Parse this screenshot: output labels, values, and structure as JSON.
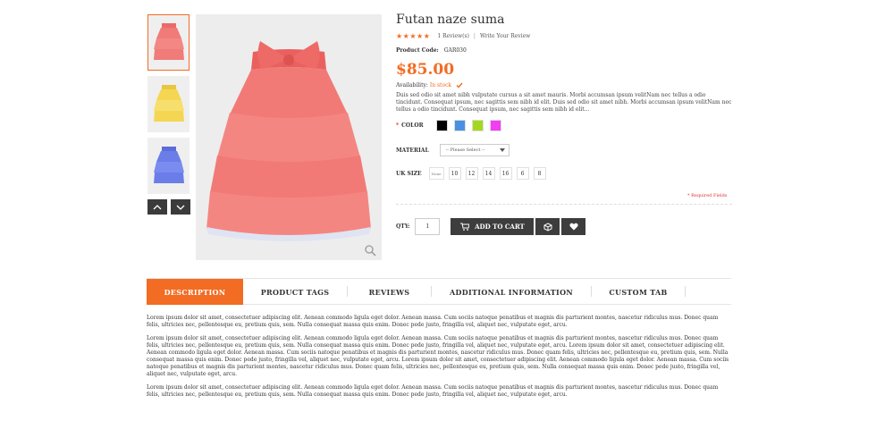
{
  "product": {
    "title": "Futan naze suma",
    "reviews_label": "1 Review(s)",
    "write_review_label": "Write Your Review",
    "code_label": "Product Code:",
    "code_value": "GAR030",
    "price": "$85.00",
    "availability_label": "Availability:",
    "availability_value": "In stock",
    "description": "Duis sed odio sit amet nibh vulputate cursus a sit amet mauris. Morbi accumsan ipsum velitNam nec tellus a odio tincidunt. Consequat ipsum, nec sagittis sem nibh id elit. Duis sed odio sit amet nibh. Morbi accumsan ipsum velitNam nec tellus a odio tincidunt. Consequat ipsum, nec sagittis sem nibh id elit..."
  },
  "rating": {
    "value": 5,
    "max": 5,
    "stars": "★★★★★"
  },
  "options": {
    "required_mark": "*",
    "color_label": "COLOR",
    "colors": [
      "#000000",
      "#4a90e2",
      "#a4d81a",
      "#f23df2"
    ],
    "material_label": "MATERIAL",
    "material_placeholder": "-- Please Select --",
    "size_label": "UK SIZE",
    "sizes": [
      "None",
      "10",
      "12",
      "14",
      "16",
      "6",
      "8"
    ],
    "required_fields": "* Required Fields"
  },
  "cart": {
    "qty_label": "QTY:",
    "qty_value": "1",
    "add_to_cart_label": "ADD TO CART"
  },
  "tabs": [
    "DESCRIPTION",
    "PRODUCT TAGS",
    "REVIEWS",
    "ADDITIONAL INFORMATION",
    "CUSTOM TAB"
  ],
  "description_paragraphs": [
    "Lorem ipsum dolor sit amet, consectetuer adipiscing elit. Aenean commodo ligula eget dolor. Aenean massa. Cum sociis natoque penatibus et magnis dis parturient montes, nascetur ridiculus mus. Donec quam felis, ultricies nec, pellentesque eu, pretium quis, sem. Nulla consequat massa quis enim. Donec pede justo, fringilla vel, aliquet nec, vulputate eget, arcu.",
    "Lorem ipsum dolor sit amet, consectetuer adipiscing elit. Aenean commodo ligula eget dolor. Aenean massa. Cum sociis natoque penatibus et magnis dis parturient montes, nascetur ridiculus mus. Donec quam felis, ultricies nec, pellentesque eu, pretium quis, sem. Nulla consequat massa quis enim. Donec pede justo, fringilla vel, aliquet nec, vulputate eget, arcu. Lorem ipsum dolor sit amet, consectetuer adipiscing elit. Aenean commodo ligula eget dolor. Aenean massa. Cum sociis natoque penatibus et magnis dis parturient montes, nascetur ridiculus mus. Donec quam felis, ultricies nec, pellentesque eu, pretium quis, sem. Nulla consequat massa quis enim. Donec pede justo, fringilla vel, aliquet nec, vulputate eget, arcu. Lorem ipsum dolor sit amet, consectetuer adipiscing elit. Aenean commodo ligula eget dolor. Aenean massa. Cum sociis natoque penatibus et magnis dis parturient montes, nascetur ridiculus mus. Donec quam felis, ultricies nec, pellentesque eu, pretium quis, sem. Nulla consequat massa quis enim. Donec pede justo, fringilla vel, aliquet nec, vulputate eget, arcu.",
    "Lorem ipsum dolor sit amet, consectetuer adipiscing elit. Aenean commodo ligula eget dolor. Aenean massa. Cum sociis natoque penatibus et magnis dis parturient montes, nascetur ridiculus mus. Donec quam felis, ultricies nec, pellentesque eu, pretium quis, sem. Nulla consequat massa quis enim. Donec pede justo, fringilla vel, aliquet nec, vulputate eget, arcu."
  ],
  "thumbnails": [
    {
      "color": "#f07b78",
      "icon": "skirt-thumbnail"
    },
    {
      "color": "#f4d653",
      "icon": "skirt-thumbnail"
    },
    {
      "color": "#6a7de8",
      "icon": "skirt-thumbnail"
    }
  ],
  "main_image": {
    "color": "#f0726f",
    "icon": "skirt-image"
  },
  "accent": "#f26c23"
}
